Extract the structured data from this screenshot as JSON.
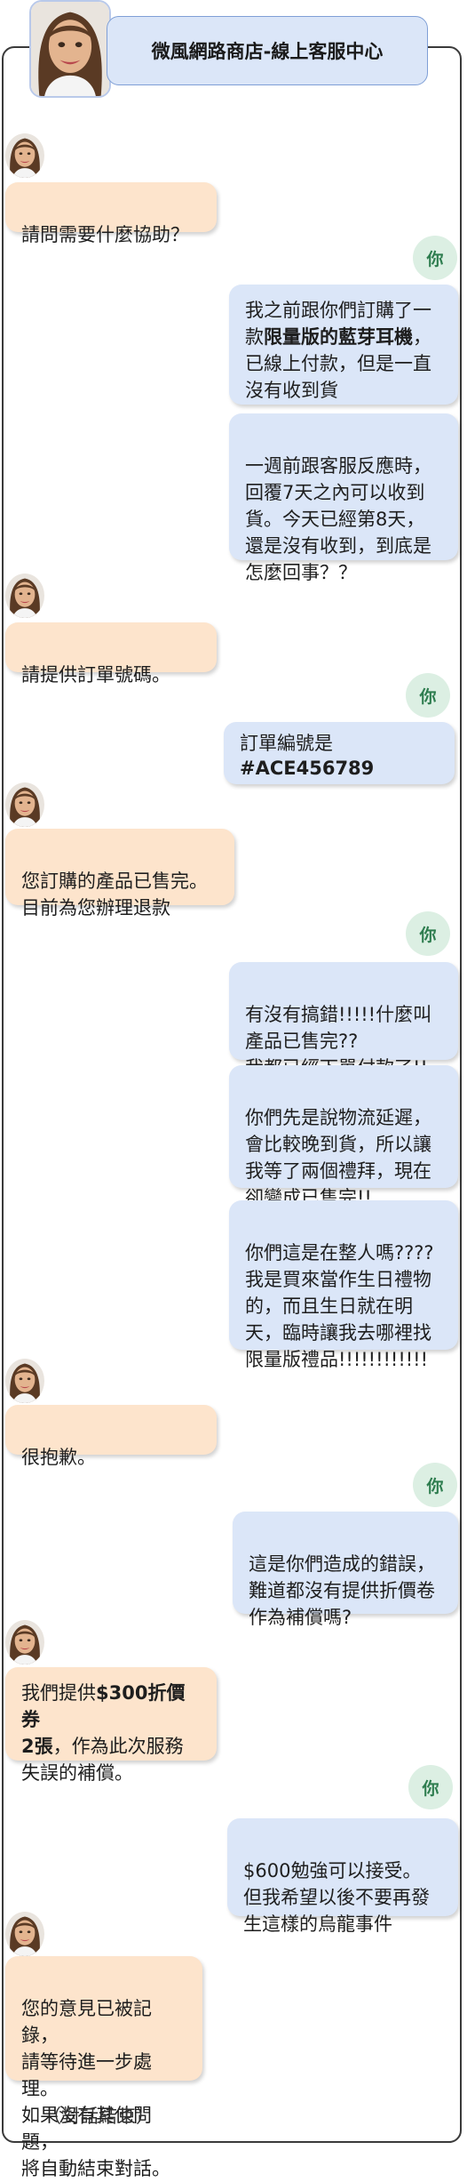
{
  "header": {
    "title": "微風網路商店-線上客服中心"
  },
  "you_label": "你",
  "colors": {
    "agent_bubble": "#fde4cc",
    "user_bubble": "#dbe6f8",
    "you_badge": "#dcefe3",
    "frame": "#3a3a3a"
  },
  "messages": {
    "m1": "請問需要什麼協助？",
    "m2a": "我之前跟你們訂購了一款",
    "m2b": "限量版的藍芽耳機",
    "m2c": "，已線上付款，但是一直沒有收到貨",
    "m3": "一週前跟客服反應時，\n回覆7天之內可以收到\n貨。今天已經第8天，\n還是沒有收到，到底是\n怎麼回事？？",
    "m4": "請提供訂單號碼。",
    "m5a": "訂單編號是",
    "m5b": "#ACE456789",
    "m6": "您訂購的產品已售完。\n目前為您辦理退款",
    "m7": "有沒有搞錯!!!!!什麼叫\n產品已售完??\n我都已經下單付款了!!",
    "m8": "你們先是說物流延遲，\n會比較晚到貨，所以讓\n我等了兩個禮拜，現在\n卻變成已售完!!",
    "m9": "你們這是在整人嗎????\n我是買來當作生日禮物\n的，而且生日就在明\n天，臨時讓我去哪裡找\n限量版禮品!!!!!!!!!!!!",
    "m10": "很抱歉。",
    "m11": "這是你們造成的錯誤，\n難道都沒有提供折價卷\n作為補償嗎?",
    "m12a": "我們提供",
    "m12b": "$300折價券\n2張",
    "m12c": "，作為此次服務\n失誤的補償。",
    "m13": "$600勉強可以接受。\n但我希望以後不要再發\n生這樣的烏龍事件",
    "m14": "您的意見已被記錄，\n請等待進一步處理。\n如果沒有其他問題，\n將自動結束對話。"
  },
  "end_text": "（對話結束）"
}
